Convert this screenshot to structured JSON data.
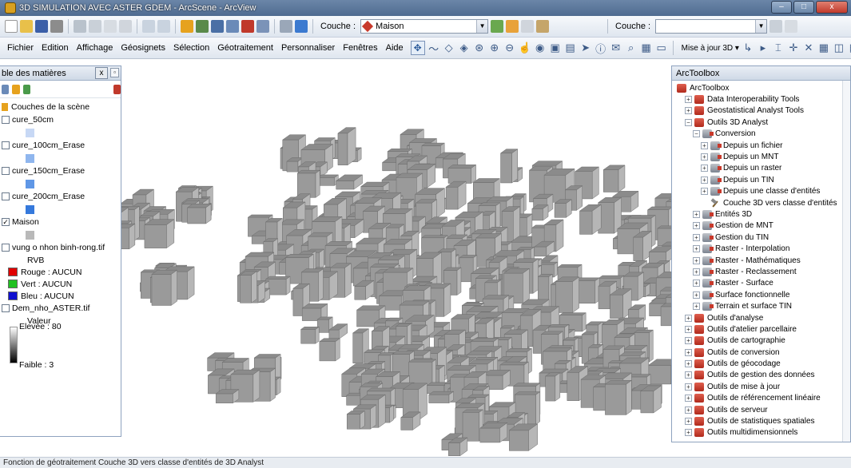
{
  "window": {
    "title": "3D SIMULATION AVEC ASTER GDEM - ArcScene - ArcView",
    "min_label": "–",
    "max_label": "□",
    "close_label": "x"
  },
  "toolbar": {
    "layer_label": "Couche :",
    "layer_value": "Maison",
    "layer2_label": "Couche :",
    "layer2_value": ""
  },
  "menu": {
    "items": [
      "Fichier",
      "Edition",
      "Affichage",
      "Géosignets",
      "Sélection",
      "Géotraitement",
      "Personnaliser",
      "Fenêtres",
      "Aide"
    ],
    "update_label": "Mise à jour 3D ▾"
  },
  "toc": {
    "title": "ble des matières",
    "close_label": "x",
    "pin_label": "▫",
    "scene_label": "Couches de la scène",
    "layers": [
      {
        "label": "cure_50cm",
        "checked": false,
        "color": "#c7d8f5"
      },
      {
        "label": "cure_100cm_Erase",
        "checked": false,
        "color": "#8fb6ee"
      },
      {
        "label": "cure_150cm_Erase",
        "checked": false,
        "color": "#5f97e6"
      },
      {
        "label": "cure_200cm_Erase",
        "checked": false,
        "color": "#3579dc"
      },
      {
        "label": "Maison",
        "checked": true,
        "color": "#b9b9b9"
      }
    ],
    "raster1": {
      "label": "vung o nhon binh-rong.tif",
      "mode": "RVB",
      "bands": [
        {
          "label": "Rouge :  AUCUN",
          "color": "#e00000"
        },
        {
          "label": "Vert : AUCUN",
          "color": "#20c020"
        },
        {
          "label": "Bleu :  AUCUN",
          "color": "#1010d0"
        }
      ]
    },
    "raster2": {
      "label": "Dem_nho_ASTER.tif",
      "value_label": "Valeur",
      "high": "Elevée : 80",
      "low": "Faible : 3"
    }
  },
  "toolbox": {
    "title": "ArcToolbox",
    "items": [
      {
        "label": "ArcToolbox",
        "level": 0,
        "icon": "red",
        "exp": ""
      },
      {
        "label": "Data Interoperability Tools",
        "level": 1,
        "icon": "red",
        "exp": "+"
      },
      {
        "label": "Geostatistical Analyst Tools",
        "level": 1,
        "icon": "red",
        "exp": "+"
      },
      {
        "label": "Outils 3D Analyst",
        "level": 1,
        "icon": "red",
        "exp": "−"
      },
      {
        "label": "Conversion",
        "level": 2,
        "icon": "gray",
        "exp": "−"
      },
      {
        "label": "Depuis un fichier",
        "level": 3,
        "icon": "gray",
        "exp": "+"
      },
      {
        "label": "Depuis un MNT",
        "level": 3,
        "icon": "gray",
        "exp": "+"
      },
      {
        "label": "Depuis un raster",
        "level": 3,
        "icon": "gray",
        "exp": "+"
      },
      {
        "label": "Depuis un TIN",
        "level": 3,
        "icon": "gray",
        "exp": "+"
      },
      {
        "label": "Depuis une classe d'entités",
        "level": 3,
        "icon": "gray",
        "exp": "+"
      },
      {
        "label": "Couche 3D vers classe d'entités",
        "level": 3,
        "icon": "hammer",
        "exp": ""
      },
      {
        "label": "Entités 3D",
        "level": 2,
        "icon": "gray",
        "exp": "+"
      },
      {
        "label": "Gestion de MNT",
        "level": 2,
        "icon": "gray",
        "exp": "+"
      },
      {
        "label": "Gestion du TIN",
        "level": 2,
        "icon": "gray",
        "exp": "+"
      },
      {
        "label": "Raster - Interpolation",
        "level": 2,
        "icon": "gray",
        "exp": "+"
      },
      {
        "label": "Raster - Mathématiques",
        "level": 2,
        "icon": "gray",
        "exp": "+"
      },
      {
        "label": "Raster - Reclassement",
        "level": 2,
        "icon": "gray",
        "exp": "+"
      },
      {
        "label": "Raster - Surface",
        "level": 2,
        "icon": "gray",
        "exp": "+"
      },
      {
        "label": "Surface fonctionnelle",
        "level": 2,
        "icon": "gray",
        "exp": "+"
      },
      {
        "label": "Terrain et surface TIN",
        "level": 2,
        "icon": "gray",
        "exp": "+"
      },
      {
        "label": "Outils d'analyse",
        "level": 1,
        "icon": "red",
        "exp": "+"
      },
      {
        "label": "Outils d'atelier parcellaire",
        "level": 1,
        "icon": "red",
        "exp": "+"
      },
      {
        "label": "Outils de cartographie",
        "level": 1,
        "icon": "red",
        "exp": "+"
      },
      {
        "label": "Outils de conversion",
        "level": 1,
        "icon": "red",
        "exp": "+"
      },
      {
        "label": "Outils de géocodage",
        "level": 1,
        "icon": "red",
        "exp": "+"
      },
      {
        "label": "Outils de gestion des données",
        "level": 1,
        "icon": "red",
        "exp": "+"
      },
      {
        "label": "Outils de mise à jour",
        "level": 1,
        "icon": "red",
        "exp": "+"
      },
      {
        "label": "Outils de référencement linéaire",
        "level": 1,
        "icon": "red",
        "exp": "+"
      },
      {
        "label": "Outils de serveur",
        "level": 1,
        "icon": "red",
        "exp": "+"
      },
      {
        "label": "Outils de statistiques spatiales",
        "level": 1,
        "icon": "red",
        "exp": "+"
      },
      {
        "label": "Outils multidimensionnels",
        "level": 1,
        "icon": "red",
        "exp": "+"
      }
    ]
  },
  "status": {
    "text": "Fonction de géotraitement Couche 3D vers classe d'entités de 3D Analyst"
  }
}
